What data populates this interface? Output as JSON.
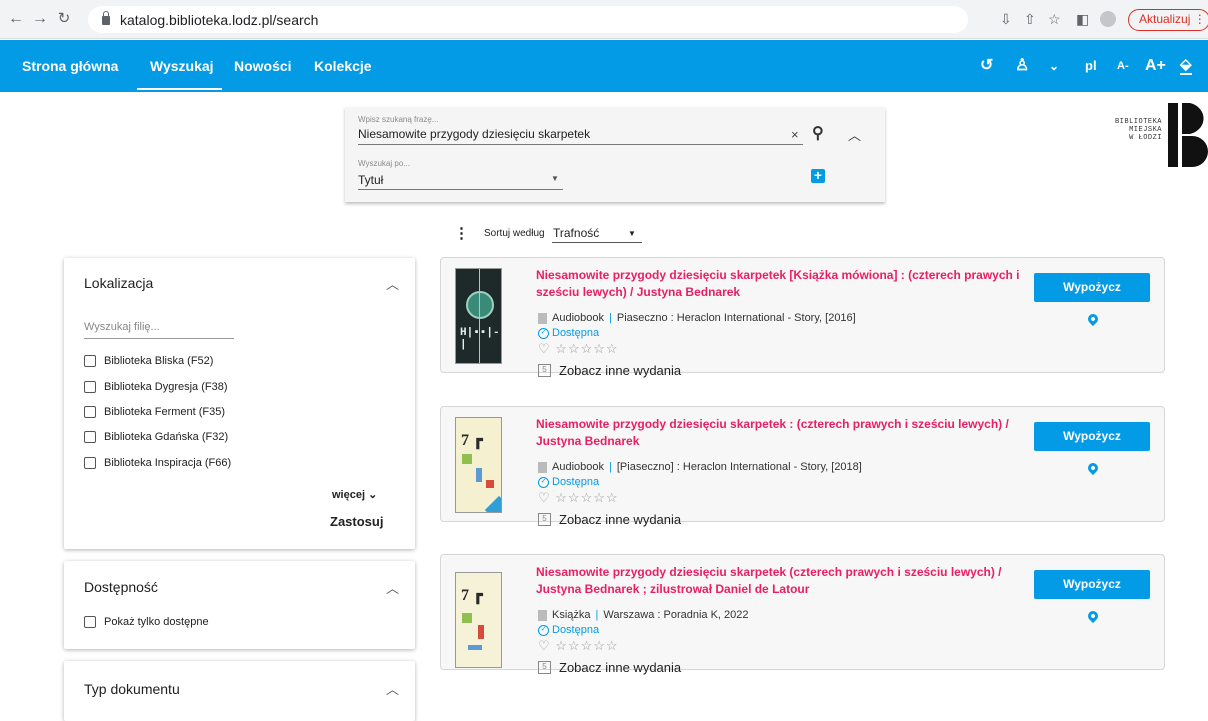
{
  "browser": {
    "url": "katalog.biblioteka.lodz.pl/search",
    "update_label": "Aktualizuj"
  },
  "topbar": {
    "menu": [
      "Strona główna",
      "Wyszukaj",
      "Nowości",
      "Kolekcje"
    ],
    "active": "Wyszukaj",
    "lang": "pl",
    "font_smaller": "A-",
    "font_larger": "A+"
  },
  "search": {
    "phrase_label": "Wpisz szukaną frazę...",
    "phrase_value": "Niesamowite przygody dziesięciu skarpetek",
    "by_label": "Wyszukaj po...",
    "by_value": "Tytuł"
  },
  "logo": {
    "line1": "BIBLIOTEKA",
    "line2": "MIEJSKA",
    "line3": "W ŁODZI"
  },
  "sort": {
    "label": "Sortuj według",
    "value": "Trafność"
  },
  "filters": {
    "location": {
      "title": "Lokalizacja",
      "placeholder": "Wyszukaj filię...",
      "options": [
        "Biblioteka Bliska (F52)",
        "Biblioteka Dygresja (F38)",
        "Biblioteka Ferment (F35)",
        "Biblioteka Gdańska (F32)",
        "Biblioteka Inspiracja (F66)"
      ],
      "more": "więcej",
      "apply": "Zastosuj"
    },
    "availability": {
      "title": "Dostępność",
      "option": "Pokaż tylko dostępne"
    },
    "doctype": {
      "title": "Typ dokumentu"
    }
  },
  "results": [
    {
      "title": "Niesamowite przygody dziesięciu skarpetek [Książka mówiona] : (czterech prawych i sześciu lewych) / Justyna Bednarek",
      "type": "Audiobook",
      "publisher": "Piaseczno : Heraclon International - Story, [2016]",
      "status": "Dostępna",
      "editions": "Zobacz inne wydania",
      "borrow": "Wypożycz"
    },
    {
      "title": "Niesamowite przygody dziesięciu skarpetek : (czterech prawych i sześciu lewych) / Justyna Bednarek",
      "type": "Audiobook",
      "publisher": "[Piaseczno] : Heraclon International - Story, [2018]",
      "status": "Dostępna",
      "editions": "Zobacz inne wydania",
      "borrow": "Wypożycz"
    },
    {
      "title": "Niesamowite przygody dziesięciu skarpetek (czterech prawych i sześciu lewych) / Justyna Bednarek ; zilustrował Daniel de Latour",
      "type": "Książka",
      "publisher": "Warszawa : Poradnia K, 2022",
      "status": "Dostępna",
      "editions": "Zobacz inne wydania",
      "borrow": "Wypożycz"
    }
  ],
  "colors": {
    "accent": "#039be5",
    "title": "#e91e63",
    "update": "#d93025"
  }
}
